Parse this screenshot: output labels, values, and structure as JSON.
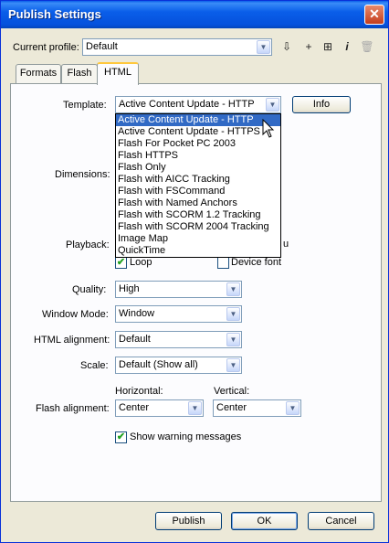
{
  "window": {
    "title": "Publish Settings",
    "close": "✕"
  },
  "profile": {
    "label": "Current profile:",
    "value": "Default"
  },
  "toolbar": {
    "import_export": "⇩",
    "add": "+",
    "duplicate": "⊞",
    "info": "i",
    "delete": "🗑"
  },
  "tabs": [
    {
      "label": "Formats"
    },
    {
      "label": "Flash"
    },
    {
      "label": "HTML"
    }
  ],
  "template": {
    "label": "Template:",
    "value": "Active Content Update - HTTP",
    "info_button": "Info",
    "options": [
      "Active Content Update - HTTP",
      "Active Content Update - HTTPS",
      "Flash For Pocket PC 2003",
      "Flash HTTPS",
      "Flash Only",
      "Flash with AICC Tracking",
      "Flash with FSCommand",
      "Flash with Named Anchors",
      "Flash with SCORM 1.2 Tracking",
      "Flash with SCORM 2004 Tracking",
      "Image Map",
      "QuickTime"
    ]
  },
  "dimensions": {
    "label": "Dimensions:"
  },
  "playback": {
    "label": "Playback:",
    "partial_right": "u",
    "loop_label": "Loop",
    "loop_checked": true,
    "device_font_label": "Device font",
    "device_font_checked": false
  },
  "quality": {
    "label": "Quality:",
    "value": "High"
  },
  "window_mode": {
    "label": "Window Mode:",
    "value": "Window"
  },
  "html_alignment": {
    "label": "HTML alignment:",
    "value": "Default"
  },
  "scale": {
    "label": "Scale:",
    "value": "Default (Show all)"
  },
  "flash_alignment": {
    "label": "Flash alignment:",
    "horizontal_label": "Horizontal:",
    "horizontal_value": "Center",
    "vertical_label": "Vertical:",
    "vertical_value": "Center"
  },
  "warnings": {
    "label": "Show warning messages",
    "checked": true
  },
  "buttons": {
    "publish": "Publish",
    "ok": "OK",
    "cancel": "Cancel"
  },
  "icons": {
    "dropdown_arrow": "▼",
    "checkmark": "✔"
  }
}
